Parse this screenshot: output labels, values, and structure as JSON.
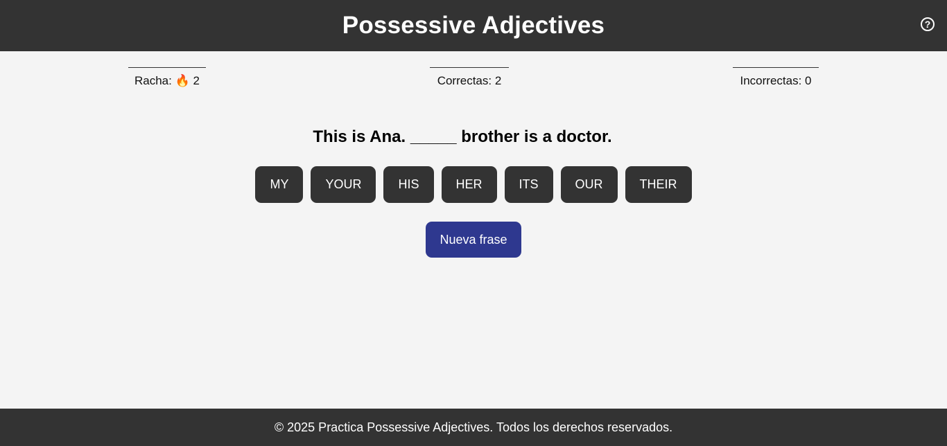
{
  "header": {
    "title": "Possessive Adjectives",
    "help_icon": "question-circle-icon",
    "help_glyph": "?"
  },
  "stats": {
    "streak_label": "Racha:",
    "streak_icon": "fire-icon",
    "streak_glyph": "🔥",
    "streak_value": "2",
    "correct_text": "Correctas: 2",
    "incorrect_text": "Incorrectas: 0"
  },
  "exercise": {
    "sentence": "This is Ana. _____ brother is a doctor."
  },
  "options": [
    {
      "label": "MY"
    },
    {
      "label": "YOUR"
    },
    {
      "label": "HIS"
    },
    {
      "label": "HER"
    },
    {
      "label": "ITS"
    },
    {
      "label": "OUR"
    },
    {
      "label": "THEIR"
    }
  ],
  "actions": {
    "new_sentence_label": "Nueva frase"
  },
  "footer": {
    "text": "© 2025 Practica Possessive Adjectives. Todos los derechos reservados."
  },
  "colors": {
    "header_bg": "#333333",
    "button_bg": "#333333",
    "primary_button": "#2e388f",
    "page_bg": "#f4f4f4"
  }
}
